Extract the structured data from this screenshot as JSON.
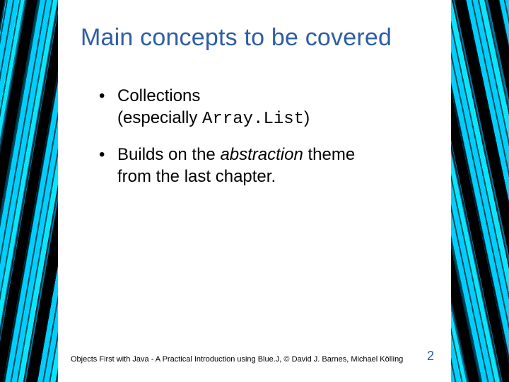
{
  "title": "Main concepts to be covered",
  "bullets": [
    {
      "line1": "Collections",
      "line2_pre": "(especially ",
      "line2_code": "Array.List",
      "line2_post": ")"
    },
    {
      "line1_pre": "Builds on the ",
      "line1_em": "abstraction",
      "line1_post": " theme",
      "line2": "from the last chapter."
    }
  ],
  "footer": "Objects First with Java - A Practical Introduction using Blue.J, © David J. Barnes, Michael Kölling",
  "page_number": "2"
}
